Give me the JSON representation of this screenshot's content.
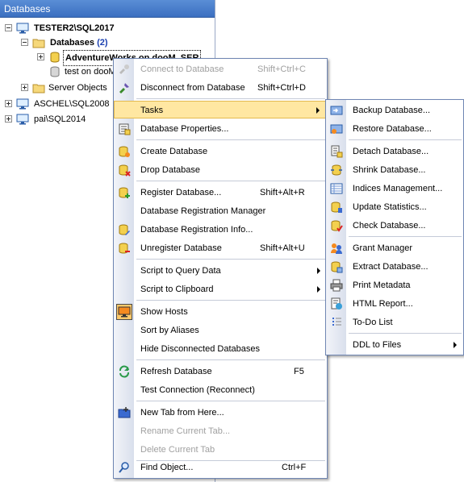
{
  "panel": {
    "title": "Databases"
  },
  "tree": {
    "server1": "TESTER2\\SQL2017",
    "databases_label": "Databases",
    "databases_count": "(2)",
    "db1": "AdventureWorks on dooM_SER",
    "db2": "test on dooM",
    "server_objects": "Server Objects",
    "server2": "ASCHEL\\SQL2008",
    "server3": "pai\\SQL2014"
  },
  "context_menu": {
    "connect": {
      "label": "Connect to Database",
      "shortcut": "Shift+Ctrl+C"
    },
    "disconnect": {
      "label": "Disconnect from Database",
      "shortcut": "Shift+Ctrl+D"
    },
    "tasks": {
      "label": "Tasks"
    },
    "db_properties": {
      "label": "Database Properties..."
    },
    "create_db": {
      "label": "Create Database"
    },
    "drop_db": {
      "label": "Drop Database"
    },
    "register_db": {
      "label": "Register Database...",
      "shortcut": "Shift+Alt+R"
    },
    "reg_manager": {
      "label": "Database Registration Manager"
    },
    "reg_info": {
      "label": "Database Registration Info..."
    },
    "unregister_db": {
      "label": "Unregister Database",
      "shortcut": "Shift+Alt+U"
    },
    "script_query": {
      "label": "Script to Query Data"
    },
    "script_clipboard": {
      "label": "Script to Clipboard"
    },
    "show_hosts": {
      "label": "Show Hosts"
    },
    "sort_aliases": {
      "label": "Sort by Aliases"
    },
    "hide_disconnected": {
      "label": "Hide Disconnected Databases"
    },
    "refresh_db": {
      "label": "Refresh Database",
      "shortcut": "F5"
    },
    "test_connection": {
      "label": "Test Connection (Reconnect)"
    },
    "new_tab": {
      "label": "New Tab from Here..."
    },
    "rename_tab": {
      "label": "Rename Current Tab..."
    },
    "delete_tab": {
      "label": "Delete Current Tab"
    },
    "find_object": {
      "label": "Find Object...",
      "shortcut": "Ctrl+F"
    }
  },
  "tasks_submenu": {
    "backup": "Backup Database...",
    "restore": "Restore Database...",
    "detach": "Detach Database...",
    "shrink": "Shrink Database...",
    "indices": "Indices Management...",
    "update_stats": "Update Statistics...",
    "check_db": "Check Database...",
    "grant_manager": "Grant Manager",
    "extract_db": "Extract Database...",
    "print_metadata": "Print Metadata",
    "html_report": "HTML Report...",
    "todo_list": "To-Do List",
    "ddl_files": "DDL to Files"
  },
  "colors": {
    "header": "#3b6fc0",
    "highlight": "#ffe7a2",
    "menu_border": "#6f86b3"
  }
}
